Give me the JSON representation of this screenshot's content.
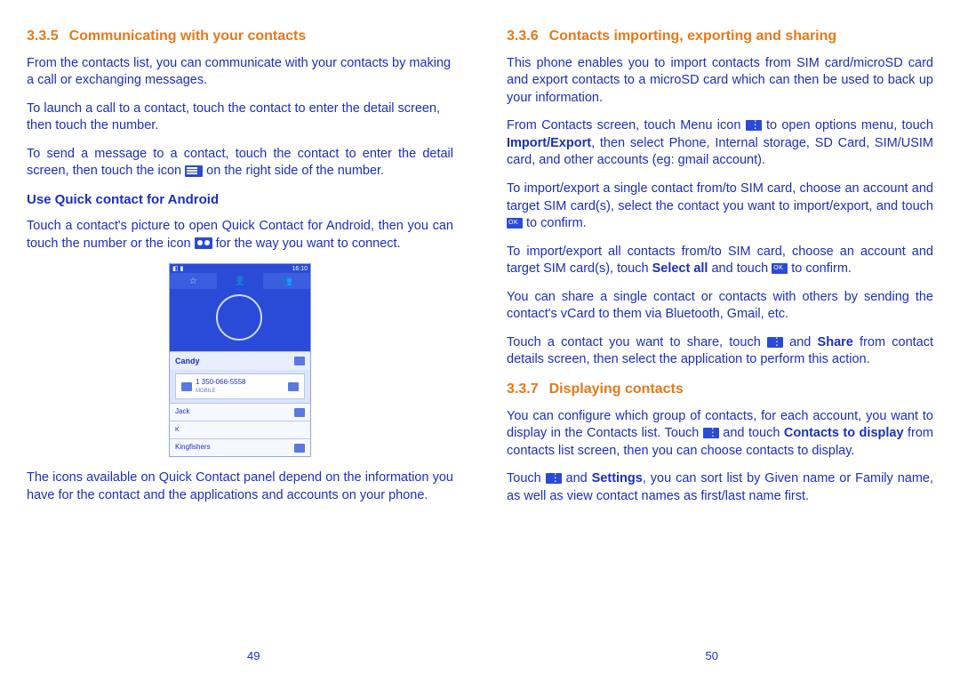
{
  "left": {
    "section_num": "3.3.5",
    "section_title": "Communicating with your contacts",
    "p1": "From the contacts list, you can communicate with your contacts by making a call or exchanging messages.",
    "p2": "To launch a call to a contact, touch the contact to enter the detail screen, then touch the number.",
    "p3a": "To send a message to a contact, touch the contact to enter the detail screen, then touch the icon ",
    "p3b": " on the right side of the number.",
    "sub1": "Use Quick contact for Android",
    "p4a": "Touch a contact's picture to open Quick Contact for Android, then you can touch the number or the icon ",
    "p4b": " for the way you want to connect.",
    "p5": "The icons available on Quick Contact panel depend on the information you have for the contact and the applications and accounts on your phone.",
    "page": "49",
    "phone": {
      "time": "16:10",
      "name": "Candy",
      "number": "1 350-066-5558",
      "numlabel": "MOBILE",
      "c2": "Jack",
      "c3": "Kingfishers"
    }
  },
  "right": {
    "s1_num": "3.3.6",
    "s1_title": "Contacts importing, exporting and sharing",
    "p1": "This phone enables you to import contacts from SIM card/microSD card and export contacts to a microSD card which can then be used to back up your information.",
    "p2a": "From Contacts screen, touch Menu icon ",
    "p2b": " to open options menu, touch ",
    "p2c": "Import/Export",
    "p2d": ", then select Phone, Internal storage, SD Card, SIM/USIM card, and other accounts (eg: gmail account).",
    "p3a": "To import/export a single contact from/to SIM card, choose an account and target SIM card(s), select the contact you want to import/export, and touch ",
    "p3b": " to confirm.",
    "p4a": "To import/export all contacts from/to SIM card, choose an account  and target SIM card(s), touch ",
    "p4b": "Select all",
    "p4c": " and touch ",
    "p4d": " to confirm.",
    "p5": "You can share a single contact or contacts with others by sending the contact's vCard to them via Bluetooth, Gmail, etc.",
    "p6a": "Touch a contact you want to share, touch ",
    "p6b": " and ",
    "p6c": "Share",
    "p6d": " from contact details screen, then select the application to perform this action.",
    "s2_num": "3.3.7",
    "s2_title": "Displaying contacts",
    "p7a": "You can configure which group of contacts, for each account, you want to display in the Contacts list. Touch ",
    "p7b": " and touch ",
    "p7c": "Contacts to display",
    "p7d": " from contacts list screen, then you can choose contacts to display.",
    "p8a": "Touch ",
    "p8b": " and ",
    "p8c": "Settings",
    "p8d": ", you can sort list by Given name or Family name, as well as view contact names as first/last name first.",
    "page": "50"
  }
}
